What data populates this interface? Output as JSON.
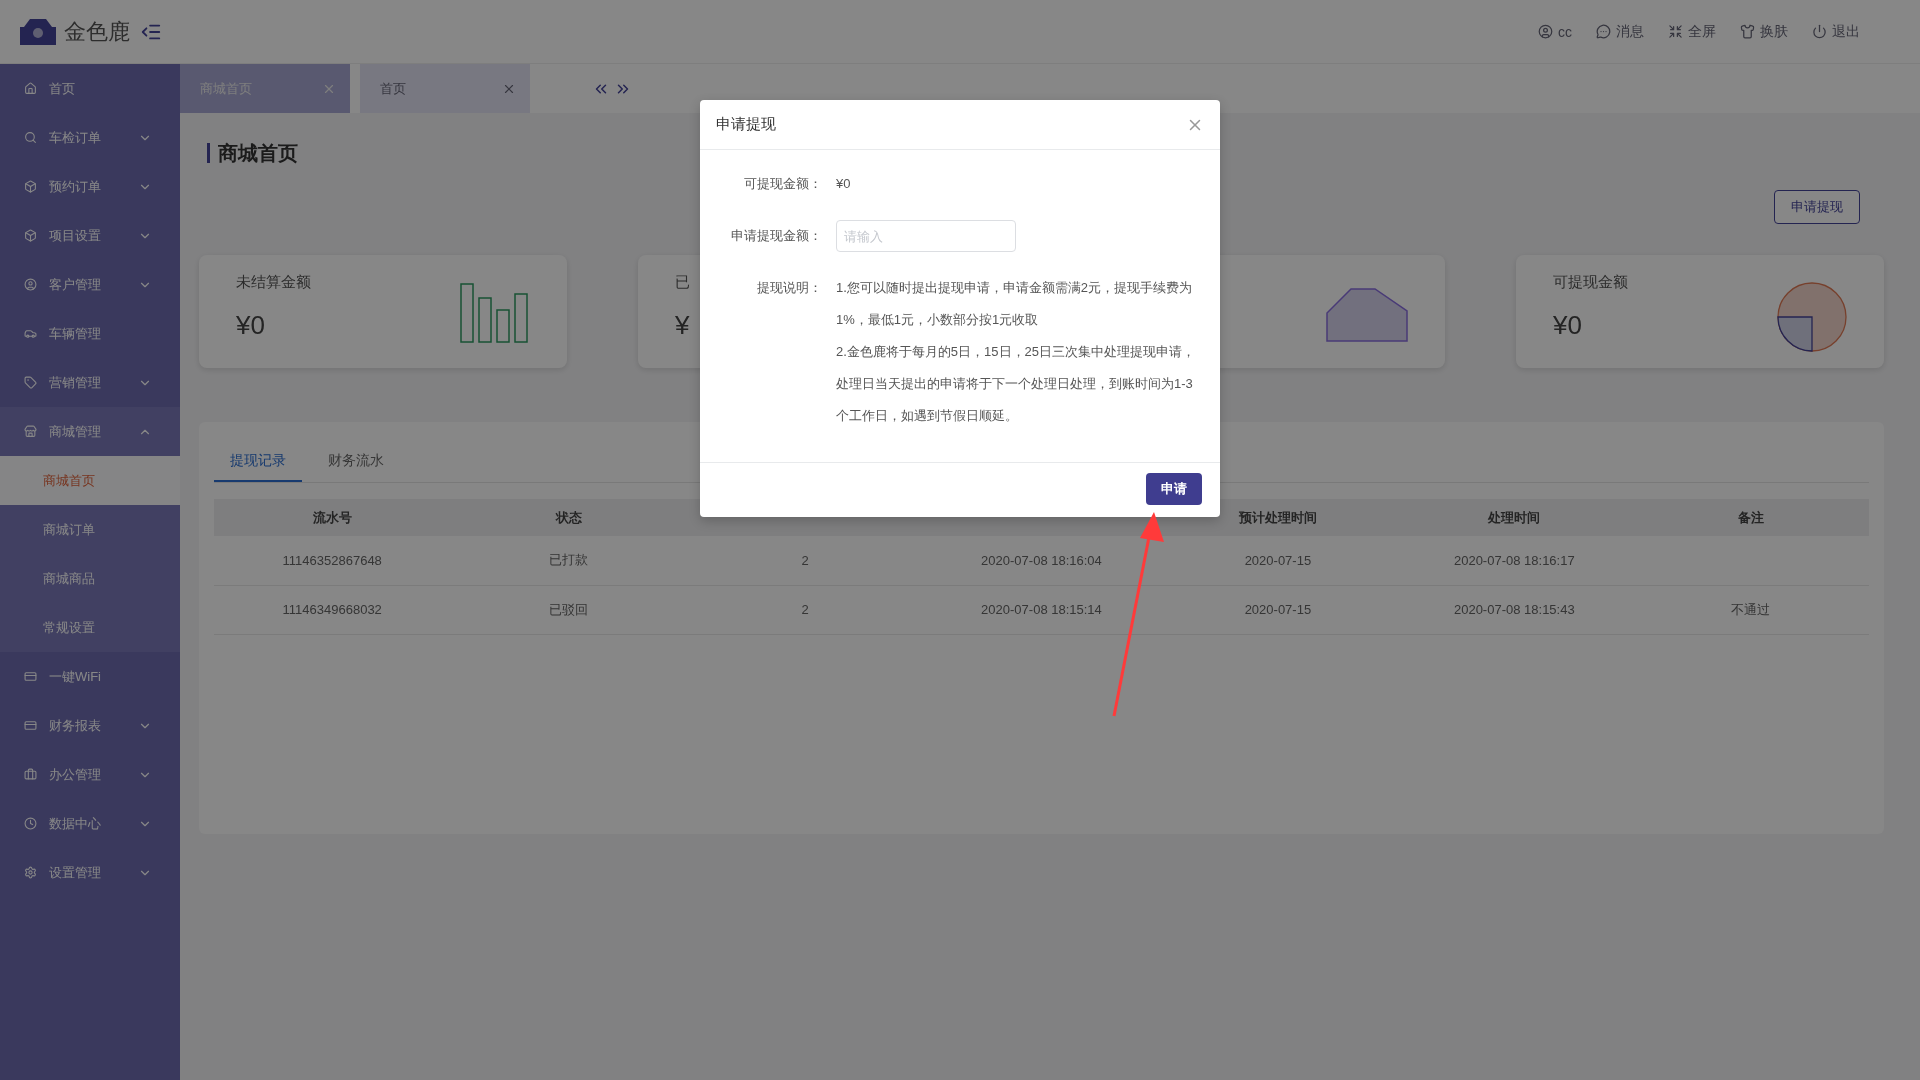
{
  "header": {
    "brand": "金色鹿",
    "actions": [
      {
        "kind": "user",
        "label": "cc"
      },
      {
        "kind": "message",
        "label": "消息"
      },
      {
        "kind": "fullscreen",
        "label": "全屏"
      },
      {
        "kind": "skin",
        "label": "换肤"
      },
      {
        "kind": "logout",
        "label": "退出"
      }
    ]
  },
  "sidebar": {
    "items": [
      {
        "kind": "link",
        "label": "首页"
      },
      {
        "kind": "group",
        "label": "车检订单",
        "expanded": false
      },
      {
        "kind": "group",
        "label": "预约订单",
        "expanded": false
      },
      {
        "kind": "group",
        "label": "项目设置",
        "expanded": false
      },
      {
        "kind": "group",
        "label": "客户管理",
        "expanded": false
      },
      {
        "kind": "link",
        "label": "车辆管理"
      },
      {
        "kind": "group",
        "label": "营销管理",
        "expanded": false
      },
      {
        "kind": "group",
        "label": "商城管理",
        "expanded": true,
        "children": [
          {
            "label": "商城首页",
            "selected": true
          },
          {
            "label": "商城订单",
            "selected": false
          },
          {
            "label": "商城商品",
            "selected": false
          },
          {
            "label": "常规设置",
            "selected": false
          }
        ]
      },
      {
        "kind": "link",
        "label": "一键WiFi"
      },
      {
        "kind": "group",
        "label": "财务报表",
        "expanded": false
      },
      {
        "kind": "group",
        "label": "办公管理",
        "expanded": false
      },
      {
        "kind": "group",
        "label": "数据中心",
        "expanded": false
      },
      {
        "kind": "group",
        "label": "设置管理",
        "expanded": false
      }
    ]
  },
  "tabs": [
    {
      "label": "商城首页",
      "selected": true
    },
    {
      "label": "首页",
      "selected": false
    }
  ],
  "page": {
    "title": "商城首页",
    "withdraw_button": "申请提现",
    "cards": [
      {
        "kind": "bars",
        "title": "未结算金额",
        "amount": "¥0"
      },
      {
        "kind": "plain",
        "title": "已",
        "amount": "¥"
      },
      {
        "kind": "area"
      },
      {
        "kind": "pie",
        "title": "可提现金额",
        "amount": "¥0"
      }
    ],
    "record_tabs": [
      {
        "label": "提现记录",
        "selected": true
      },
      {
        "label": "财务流水",
        "selected": false
      }
    ],
    "table": {
      "columns": {
        "column_1": "流水号",
        "column_2": "状态",
        "column_5": "预计处理时间",
        "column_6": "处理时间",
        "column_7": "备注"
      },
      "rows": [
        [
          "11146352867648",
          "已打款",
          "2",
          "2020-07-08 18:16:04",
          "2020-07-15",
          "2020-07-08 18:16:17"
        ],
        [
          "11146349668032",
          "已驳回",
          "2",
          "2020-07-08 18:15:14",
          "2020-07-15",
          "2020-07-08 18:15:43",
          "不通过"
        ]
      ]
    }
  },
  "dialog": {
    "title": "申请提现",
    "available_label": "可提现金额：",
    "available_value": "¥0",
    "amount_label": "申请提现金额：",
    "amount_placeholder": "请输入",
    "notes_label": "提现说明：",
    "notes": [
      "1.您可以随时提出提现申请，申请金额需满2元，提现手续费为1%，最低1元，小数部分按1元收取",
      "2.金色鹿将于每月的5日，15日，25日三次集中处理提现申请，处理日当天提出的申请将于下一个处理日处理，到账时间为1-3个工作日，如遇到节假日顺延。"
    ],
    "submit": "申请"
  }
}
